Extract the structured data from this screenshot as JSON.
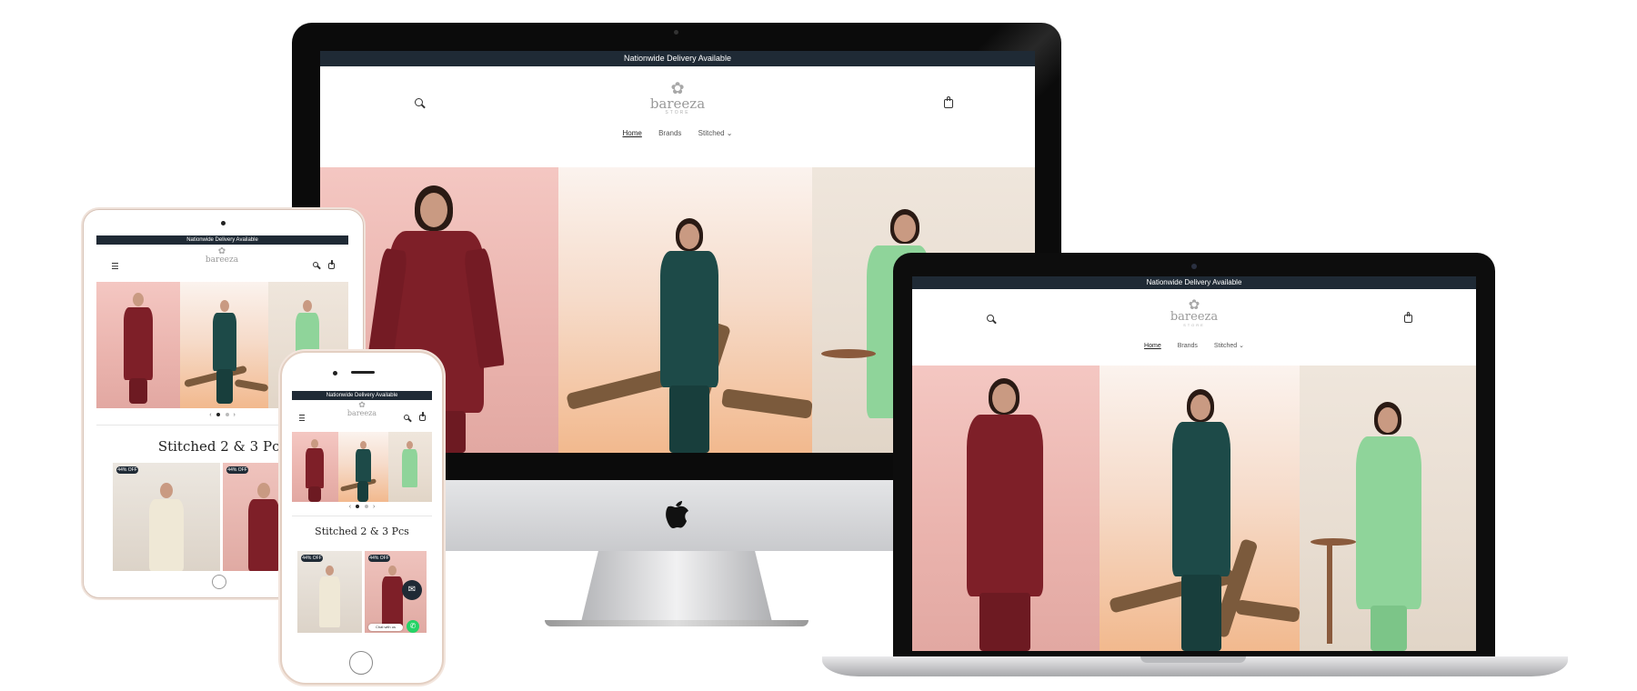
{
  "site": {
    "announcement": "Nationwide Delivery Available",
    "logo_text": "bareeza",
    "logo_subtext": "STORE",
    "nav": [
      "Home",
      "Brands",
      "Stitched"
    ],
    "section_title": "Stitched 2 & 3 Pcs",
    "badges": [
      "44% OFF",
      "44% OFF"
    ],
    "chat_label": "Chat with us"
  },
  "icons": {
    "search": "search-icon",
    "cart": "cart-icon",
    "menu": "menu-icon",
    "apple": "apple-logo-icon",
    "chevron": "chevron-down-icon",
    "chat": "chat-icon",
    "whatsapp": "whatsapp-icon"
  },
  "colors": {
    "announcement_bg": "#1f2a35",
    "dress_maroon": "#7e1f28",
    "dress_teal": "#1d4a48",
    "dress_green": "#8fd49a",
    "chat_green": "#25d366"
  }
}
